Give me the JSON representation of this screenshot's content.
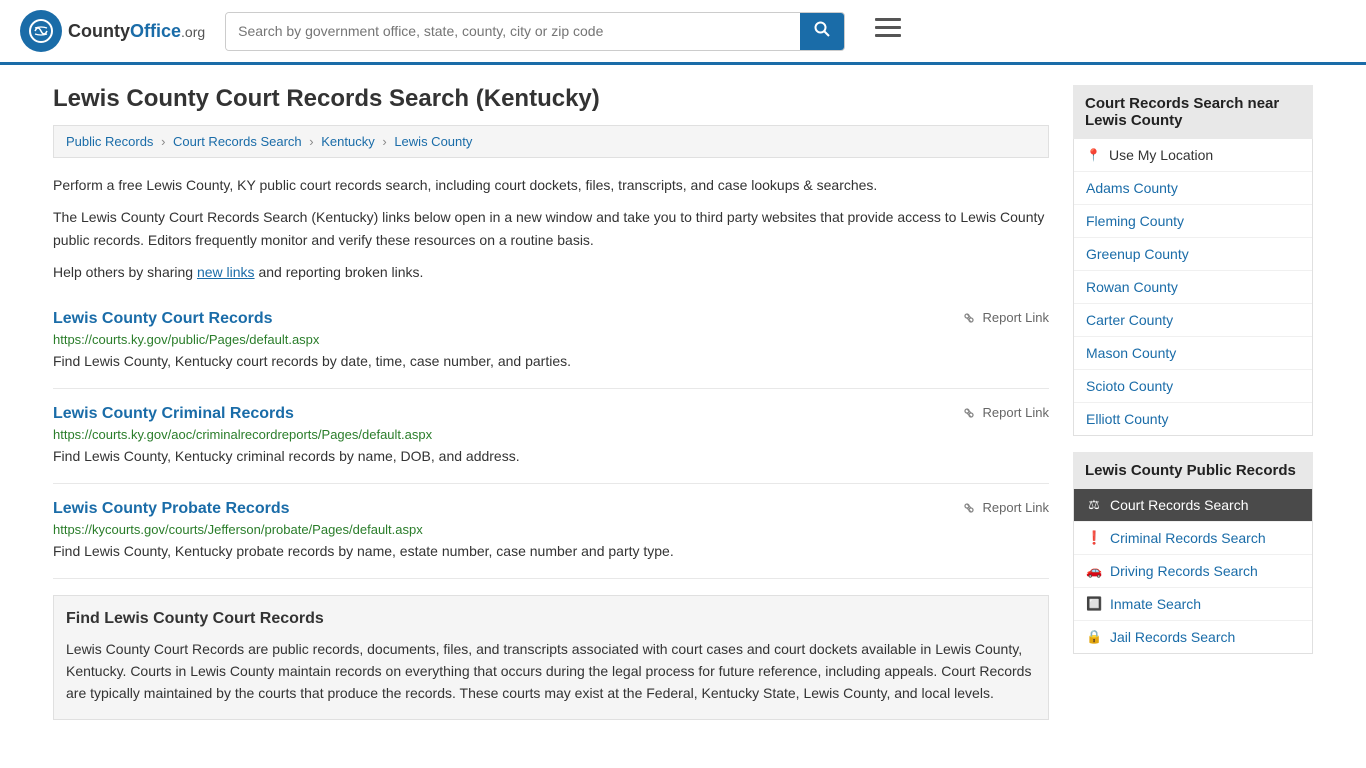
{
  "header": {
    "logo_text": "CountyOffice",
    "logo_ext": ".org",
    "search_placeholder": "Search by government office, state, county, city or zip code"
  },
  "page": {
    "title": "Lewis County Court Records Search (Kentucky)",
    "breadcrumb": [
      {
        "label": "Public Records",
        "href": "#"
      },
      {
        "label": "Court Records Search",
        "href": "#"
      },
      {
        "label": "Kentucky",
        "href": "#"
      },
      {
        "label": "Lewis County",
        "href": "#"
      }
    ],
    "description1": "Perform a free Lewis County, KY public court records search, including court dockets, files, transcripts, and case lookups & searches.",
    "description2": "The Lewis County Court Records Search (Kentucky) links below open in a new window and take you to third party websites that provide access to Lewis County public records. Editors frequently monitor and verify these resources on a routine basis.",
    "description3_prefix": "Help others by sharing ",
    "new_links_text": "new links",
    "description3_suffix": " and reporting broken links."
  },
  "records": [
    {
      "title": "Lewis County Court Records",
      "url": "https://courts.ky.gov/public/Pages/default.aspx",
      "description": "Find Lewis County, Kentucky court records by date, time, case number, and parties.",
      "report_label": "Report Link"
    },
    {
      "title": "Lewis County Criminal Records",
      "url": "https://courts.ky.gov/aoc/criminalrecordreports/Pages/default.aspx",
      "description": "Find Lewis County, Kentucky criminal records by name, DOB, and address.",
      "report_label": "Report Link"
    },
    {
      "title": "Lewis County Probate Records",
      "url": "https://kycourts.gov/courts/Jefferson/probate/Pages/default.aspx",
      "description": "Find Lewis County, Kentucky probate records by name, estate number, case number and party type.",
      "report_label": "Report Link"
    }
  ],
  "find_section": {
    "title": "Find Lewis County Court Records",
    "body": "Lewis County Court Records are public records, documents, files, and transcripts associated with court cases and court dockets available in Lewis County, Kentucky. Courts in Lewis County maintain records on everything that occurs during the legal process for future reference, including appeals. Court Records are typically maintained by the courts that produce the records. These courts may exist at the Federal, Kentucky State, Lewis County, and local levels."
  },
  "sidebar": {
    "nearby_title": "Court Records Search near Lewis County",
    "use_location": "Use My Location",
    "nearby_counties": [
      "Adams County",
      "Fleming County",
      "Greenup County",
      "Rowan County",
      "Carter County",
      "Mason County",
      "Scioto County",
      "Elliott County"
    ],
    "public_records_title": "Lewis County Public Records",
    "public_records_links": [
      {
        "label": "Court Records Search",
        "active": true,
        "icon": "⚖"
      },
      {
        "label": "Criminal Records Search",
        "active": false,
        "icon": "❗"
      },
      {
        "label": "Driving Records Search",
        "active": false,
        "icon": "🚗"
      },
      {
        "label": "Inmate Search",
        "active": false,
        "icon": "🔲"
      },
      {
        "label": "Jail Records Search",
        "active": false,
        "icon": "🔒"
      }
    ]
  }
}
